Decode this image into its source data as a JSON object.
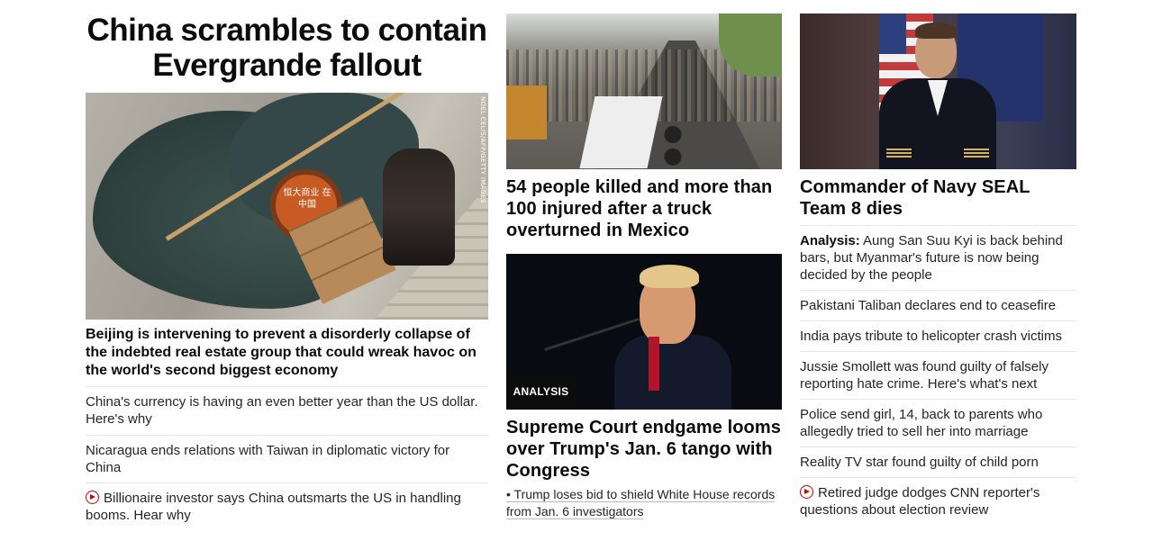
{
  "lead": {
    "headline": "China scrambles to contain Evergrande fallout",
    "image_credit": "NOEL CELIS/AFP/GETTY IMAGES",
    "image_sign_text": "恒大商业 在中国",
    "subhead": "Beijing is intervening to prevent a disorderly collapse of the indebted real estate group that could wreak havoc on the world's second biggest economy",
    "links": [
      {
        "text": "China's currency is having an even better year than the US dollar. Here's why",
        "icon": ""
      },
      {
        "text": "Nicaragua ends relations with Taiwan in diplomatic victory for China",
        "icon": ""
      },
      {
        "text": "Billionaire investor says China outsmarts the US in handling booms. Hear why",
        "icon": "play-icon"
      }
    ]
  },
  "middle": {
    "story1": {
      "headline": "54 people killed and more than 100 injured after a truck overturned in Mexico"
    },
    "story2": {
      "badge": "ANALYSIS",
      "headline": "Supreme Court endgame looms over Trump's Jan. 6 tango with Congress",
      "sublink": "• Trump loses bid to shield White House records from Jan. 6 investigators"
    }
  },
  "right": {
    "headline": "Commander of Navy SEAL Team 8 dies",
    "links": [
      {
        "prefix": "Analysis:",
        "text": " Aung San Suu Kyi is back behind bars, but Myanmar's future is now being decided by the people",
        "icon": ""
      },
      {
        "prefix": "",
        "text": "Pakistani Taliban declares end to ceasefire",
        "icon": ""
      },
      {
        "prefix": "",
        "text": "India pays tribute to helicopter crash victims",
        "icon": ""
      },
      {
        "prefix": "",
        "text": "Jussie Smollett was found guilty of falsely reporting hate crime. Here's what's next",
        "icon": ""
      },
      {
        "prefix": "",
        "text": "Police send girl, 14, back to parents who allegedly tried to sell her into marriage",
        "icon": ""
      },
      {
        "prefix": "",
        "text": "Reality TV star found guilty of child porn",
        "icon": ""
      },
      {
        "prefix": "",
        "text": "Retired judge dodges CNN reporter's questions about election review",
        "icon": "play-icon"
      }
    ]
  },
  "colors": {
    "text": "#0c0c0c",
    "divider": "#e6e6e6",
    "play": "#cc0000"
  }
}
